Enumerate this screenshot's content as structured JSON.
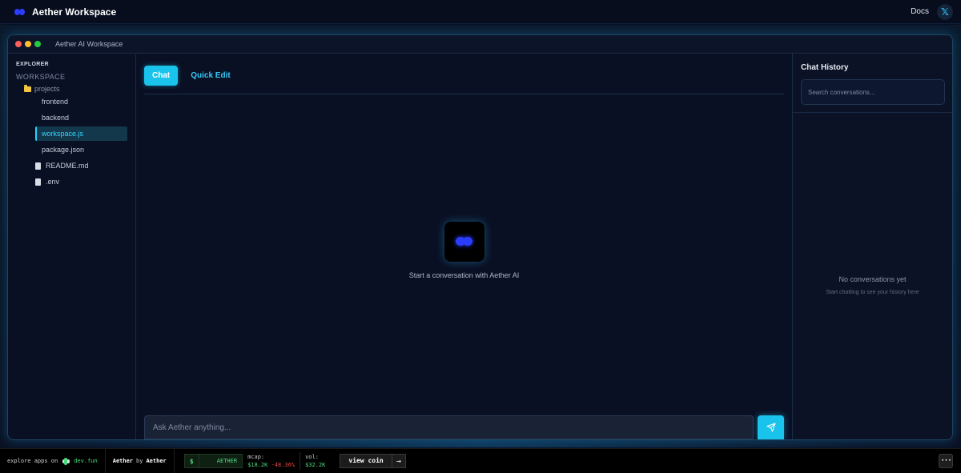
{
  "header": {
    "brand_icon": "aether-logo-icon",
    "title": "Aether Workspace",
    "docs_label": "Docs",
    "x_icon": "x-logo-icon",
    "x_label": "𝕏"
  },
  "window": {
    "title": "Aether AI Workspace"
  },
  "explorer": {
    "title": "EXPLORER",
    "workspace_label": "WORKSPACE",
    "folder": {
      "name": "projects",
      "icon": "folder-icon",
      "children": [
        "frontend",
        "backend",
        "workspace.js",
        "package.json"
      ],
      "active_child": "workspace.js"
    },
    "files": [
      {
        "name": "README.md",
        "icon": "file-icon"
      },
      {
        "name": ".env",
        "icon": "file-icon"
      }
    ]
  },
  "main": {
    "tabs": [
      {
        "label": "Chat",
        "active": true
      },
      {
        "label": "Quick Edit",
        "active": false
      }
    ],
    "empty_icon": "aether-logo-icon",
    "empty_text": "Start a conversation with Aether AI",
    "input_placeholder": "Ask Aether anything...",
    "send_icon": "send-icon"
  },
  "history": {
    "title": "Chat History",
    "search_placeholder": "Search conversations...",
    "empty_title": "No conversations yet",
    "empty_subtitle": "Start chatting to see your history here"
  },
  "footer": {
    "explore_text": "explore apps on",
    "devfun_label": "dev.fun",
    "app_name": "Aether",
    "by_text": "by",
    "author": "Aether",
    "ticker_symbol": "$",
    "ticker_name": "AETHER",
    "mcap_label": "mcap:",
    "mcap_value": "$18.2K",
    "mcap_change": "-48.36%",
    "vol_label": "vol:",
    "vol_value": "$32.2K",
    "view_coin_label": "view coin",
    "arrow": "→",
    "more_label": "···"
  },
  "colors": {
    "accent": "#19c3ec",
    "background": "#0a1024",
    "positive": "#4ade80",
    "negative": "#ef4444"
  }
}
